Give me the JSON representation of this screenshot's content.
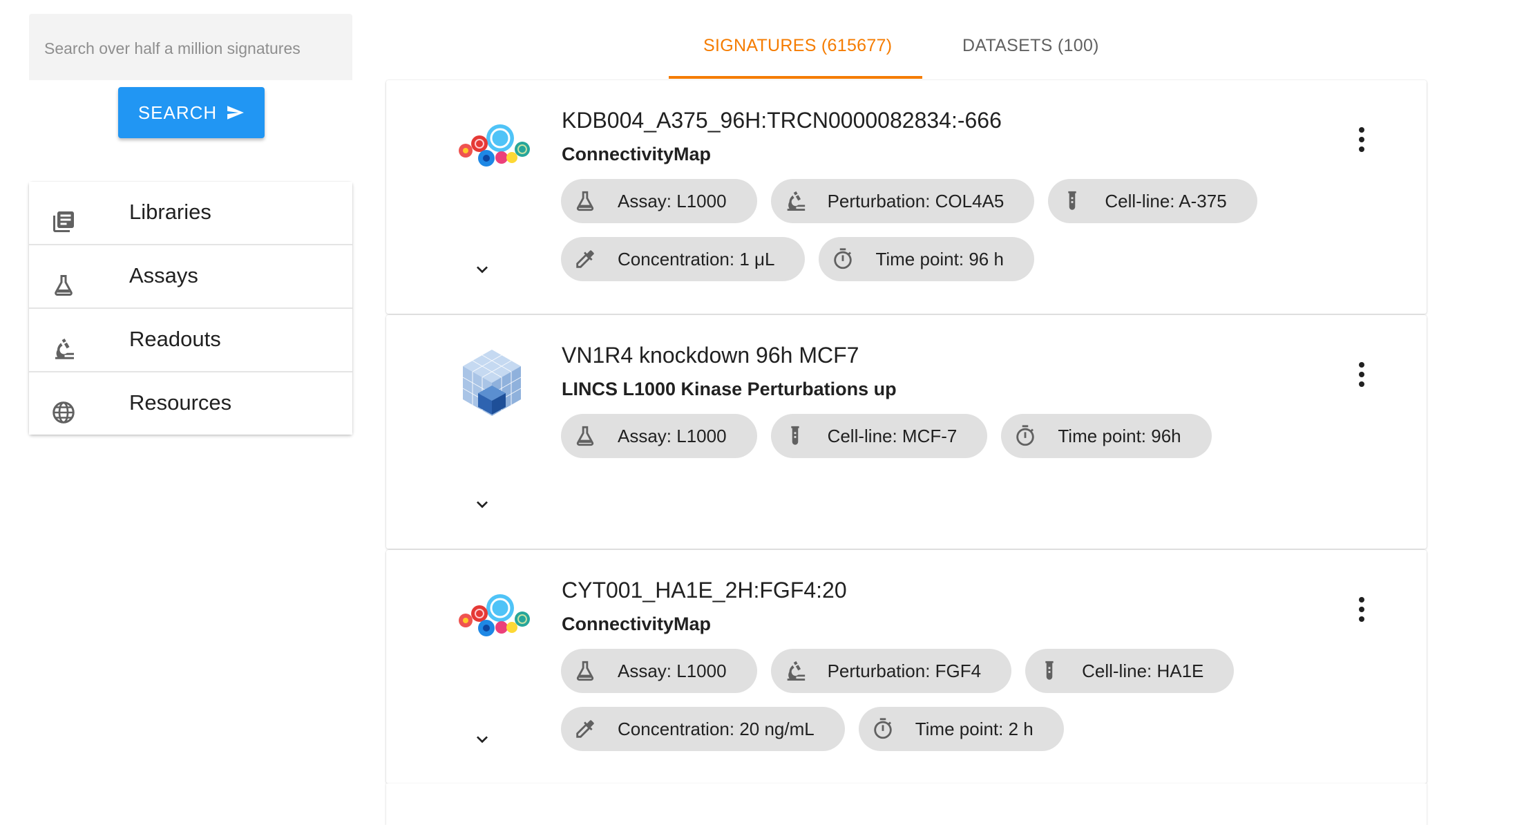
{
  "search": {
    "placeholder": "Search over half a million signatures",
    "button_label": "SEARCH"
  },
  "sidebar": {
    "items": [
      {
        "label": "Libraries",
        "icon": "library-icon"
      },
      {
        "label": "Assays",
        "icon": "flask-icon"
      },
      {
        "label": "Readouts",
        "icon": "microscope-icon"
      },
      {
        "label": "Resources",
        "icon": "globe-icon"
      }
    ]
  },
  "tabs": [
    {
      "label": "SIGNATURES (615677)",
      "active": true
    },
    {
      "label": "DATASETS (100)",
      "active": false
    }
  ],
  "colors": {
    "accent": "#f57c00",
    "primary": "#2196f3",
    "chip": "#e0e0e0"
  },
  "results": [
    {
      "title": "KDB004_A375_96H:TRCN0000082834:-666",
      "library": "ConnectivityMap",
      "logo": "connectivity-map-logo",
      "chips": [
        [
          "Assay: L1000",
          "Perturbation: COL4A5",
          "Cell-line: A-375"
        ],
        [
          "Concentration: 1 μL",
          "Time point: 96 h"
        ]
      ]
    },
    {
      "title": "VN1R4 knockdown 96h MCF7",
      "library": "LINCS L1000 Kinase Perturbations up",
      "logo": "cube-logo",
      "chips": [
        [
          "Assay: L1000",
          "Cell-line: MCF-7",
          "Time point: 96h"
        ]
      ]
    },
    {
      "title": "CYT001_HA1E_2H:FGF4:20",
      "library": "ConnectivityMap",
      "logo": "connectivity-map-logo",
      "chips": [
        [
          "Assay: L1000",
          "Perturbation: FGF4",
          "Cell-line: HA1E"
        ],
        [
          "Concentration: 20 ng/mL",
          "Time point: 2 h"
        ]
      ]
    }
  ]
}
